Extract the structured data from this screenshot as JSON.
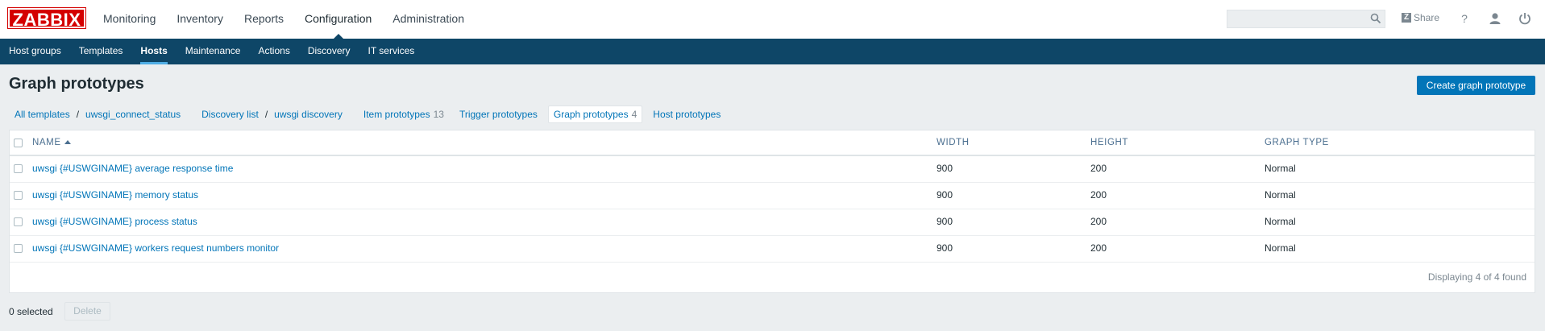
{
  "logo": {
    "text": "ZABBIX"
  },
  "main_nav": {
    "items": [
      {
        "label": "Monitoring",
        "active": false
      },
      {
        "label": "Inventory",
        "active": false
      },
      {
        "label": "Reports",
        "active": false
      },
      {
        "label": "Configuration",
        "active": true
      },
      {
        "label": "Administration",
        "active": false
      }
    ]
  },
  "header_tools": {
    "search": {
      "value": "",
      "placeholder": ""
    },
    "share_label": "Share",
    "share_badge": "Z",
    "icons": [
      "help-icon",
      "user-profile-icon",
      "sign-out-icon"
    ]
  },
  "sub_nav": {
    "items": [
      {
        "label": "Host groups",
        "active": false
      },
      {
        "label": "Templates",
        "active": false
      },
      {
        "label": "Hosts",
        "active": true
      },
      {
        "label": "Maintenance",
        "active": false
      },
      {
        "label": "Actions",
        "active": false
      },
      {
        "label": "Discovery",
        "active": false
      },
      {
        "label": "IT services",
        "active": false
      }
    ]
  },
  "page": {
    "title": "Graph prototypes",
    "create_button": "Create graph prototype"
  },
  "breadcrumbs": {
    "all_templates": "All templates",
    "template": "uwsgi_connect_status",
    "discovery_list": "Discovery list",
    "discovery_rule": "uwsgi discovery",
    "item_prototypes": "Item prototypes",
    "item_prototypes_count": "13",
    "trigger_prototypes": "Trigger prototypes",
    "graph_prototypes": "Graph prototypes",
    "graph_prototypes_count": "4",
    "host_prototypes": "Host prototypes",
    "separator": "/"
  },
  "table": {
    "columns": {
      "name": "NAME",
      "width": "WIDTH",
      "height": "HEIGHT",
      "graph_type": "GRAPH TYPE"
    },
    "rows": [
      {
        "name": "uwsgi {#USWGINAME} average response time",
        "width": "900",
        "height": "200",
        "graph_type": "Normal"
      },
      {
        "name": "uwsgi {#USWGINAME} memory status",
        "width": "900",
        "height": "200",
        "graph_type": "Normal"
      },
      {
        "name": "uwsgi {#USWGINAME} process status",
        "width": "900",
        "height": "200",
        "graph_type": "Normal"
      },
      {
        "name": "uwsgi {#USWGINAME} workers request numbers monitor",
        "width": "900",
        "height": "200",
        "graph_type": "Normal"
      }
    ],
    "footer": "Displaying 4 of 4 found"
  },
  "bulk_actions": {
    "selected": "0 selected",
    "delete_label": "Delete"
  },
  "colors": {
    "brand_red": "#d40000",
    "nav_blue": "#0e4667",
    "link_blue": "#0275b8",
    "active_underline": "#4faee5"
  }
}
